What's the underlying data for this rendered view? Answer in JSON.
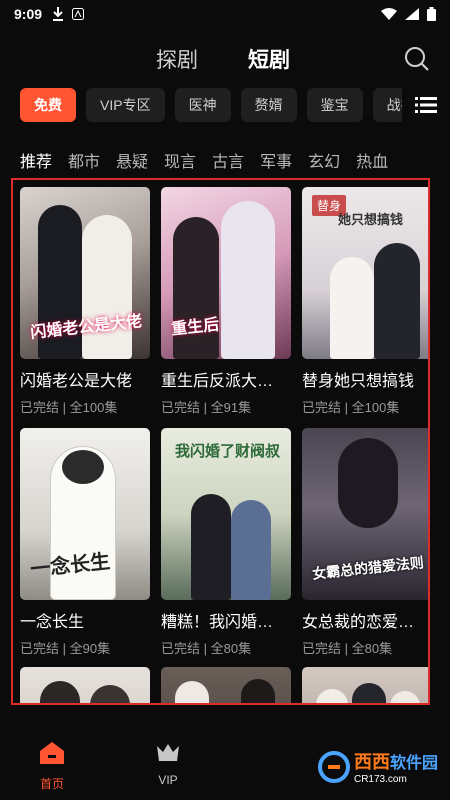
{
  "status_bar": {
    "time": "9:09"
  },
  "top_tabs": [
    {
      "label": "探剧",
      "active": false
    },
    {
      "label": "短剧",
      "active": true
    }
  ],
  "chips": [
    {
      "label": "免费",
      "active": true
    },
    {
      "label": "VIP专区",
      "active": false
    },
    {
      "label": "医神",
      "active": false
    },
    {
      "label": "赘婿",
      "active": false
    },
    {
      "label": "鉴宝",
      "active": false
    },
    {
      "label": "战神",
      "active": false
    }
  ],
  "categories": [
    {
      "label": "推荐",
      "active": true
    },
    {
      "label": "都市",
      "active": false
    },
    {
      "label": "悬疑",
      "active": false
    },
    {
      "label": "现言",
      "active": false
    },
    {
      "label": "古言",
      "active": false
    },
    {
      "label": "军事",
      "active": false
    },
    {
      "label": "玄幻",
      "active": false
    },
    {
      "label": "热血",
      "active": false
    }
  ],
  "dramas": [
    {
      "title": "闪婚老公是大佬",
      "status": "已完结",
      "episodes": "全100集",
      "poster_text": "闪婚老公是大佬"
    },
    {
      "title": "重生后反派大…",
      "status": "已完结",
      "episodes": "全91集",
      "poster_text": "重生后"
    },
    {
      "title": "替身她只想搞钱",
      "status": "已完结",
      "episodes": "全100集",
      "poster_tag": "替身",
      "poster_text": "她只想搞钱"
    },
    {
      "title": "一念长生",
      "status": "已完结",
      "episodes": "全90集",
      "poster_text": "一念长生"
    },
    {
      "title": "糟糕！我闪婚…",
      "status": "已完结",
      "episodes": "全80集",
      "poster_text": "我闪婚了财阀叔"
    },
    {
      "title": "女总裁的恋爱…",
      "status": "已完结",
      "episodes": "全80集",
      "poster_text": "女霸总的猎爱法则"
    }
  ],
  "bottom_nav": [
    {
      "label": "首页",
      "active": true
    },
    {
      "label": "VIP",
      "active": false
    }
  ],
  "watermark": {
    "brand": "西西",
    "brand_suffix": "软件园",
    "site": "CR173.com"
  },
  "colors": {
    "accent": "#ff5533",
    "highlight_frame": "#e02b2b",
    "background": "#0b0b0b"
  }
}
